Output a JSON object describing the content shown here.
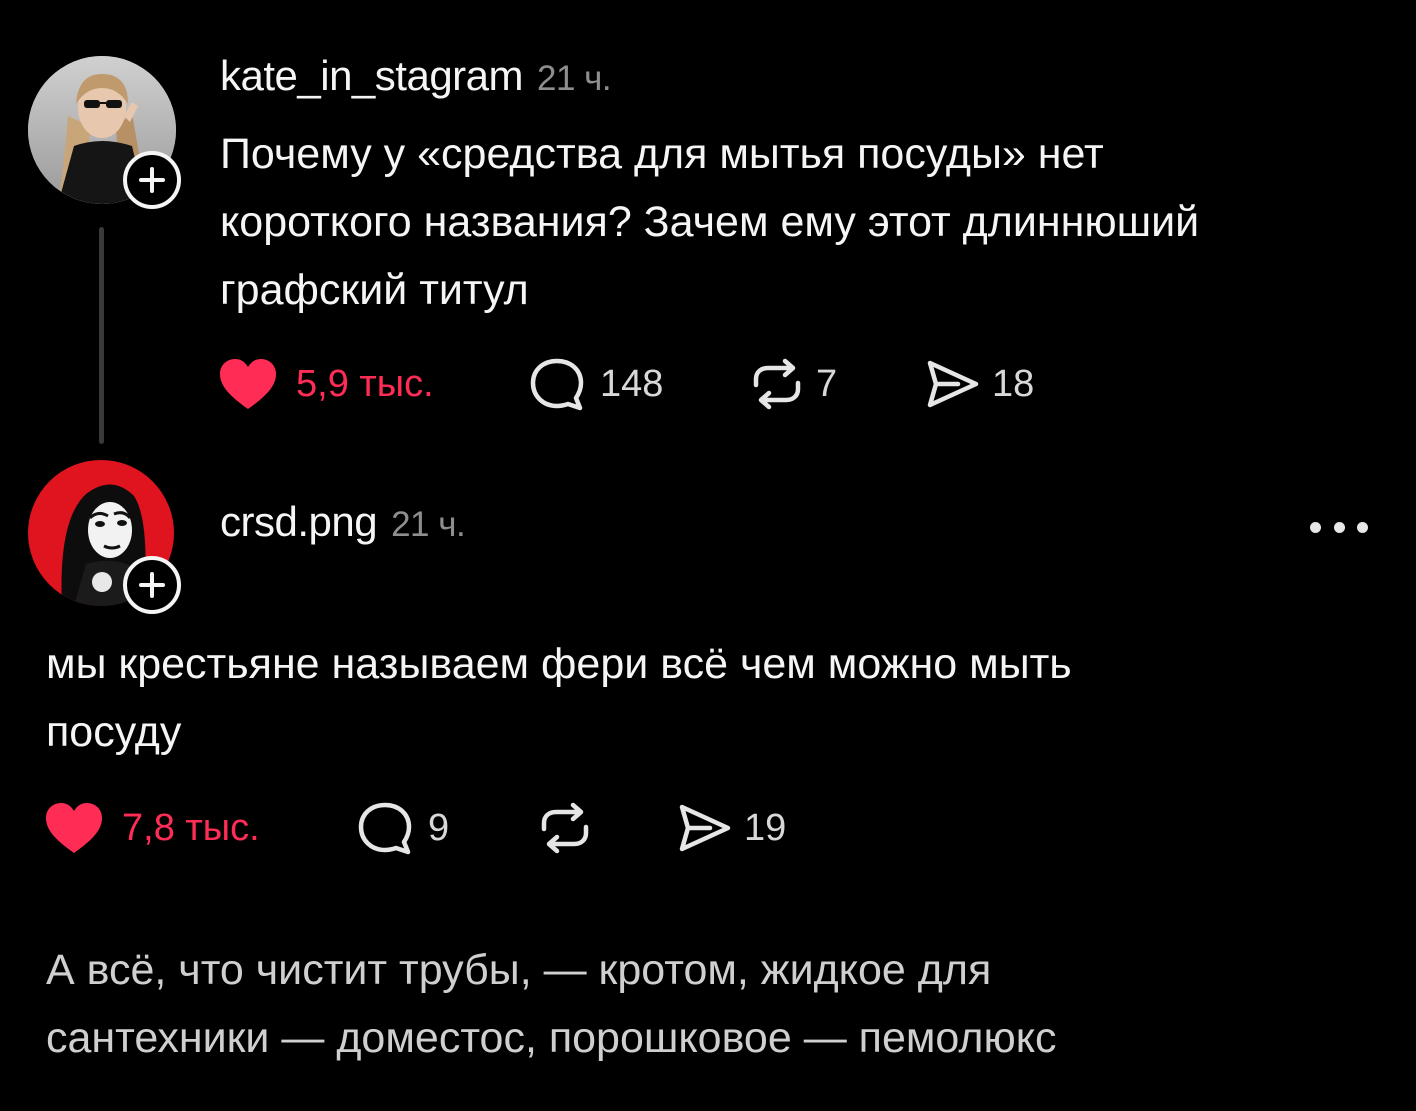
{
  "posts": [
    {
      "username": "kate_in_stagram",
      "time": "21 ч.",
      "text": "Почему у «средства для мытья посуды» нет\nкороткого названия? Зачем ему этот длиннюший\nграфский титул",
      "likes": "5,9 тыс.",
      "comments": "148",
      "reposts": "7",
      "shares": "18",
      "liked": true,
      "avatar_icon": "woman-sunglasses-photo"
    },
    {
      "username": "crsd.png",
      "time": "21 ч.",
      "text": "мы крестьяне называем фери всё чем можно мыть\nпосуду",
      "likes": "7,8 тыс.",
      "comments": "9",
      "reposts": "",
      "shares": "19",
      "liked": true,
      "avatar_icon": "red-portrait-photo"
    }
  ],
  "partial_post": {
    "text": "А всё, что чистит трубы, — кротом, жидкое для\nсантехники — доместос, порошковое — пемолюкс"
  },
  "icons": {
    "heart": "heart-icon",
    "comment": "comment-icon",
    "repost": "repost-icon",
    "share": "share-icon",
    "follow": "plus-icon",
    "more": "more-icon"
  },
  "colors": {
    "background": "#000000",
    "text": "#f5f5f5",
    "muted": "#8e8e8e",
    "like": "#ff2d55"
  }
}
